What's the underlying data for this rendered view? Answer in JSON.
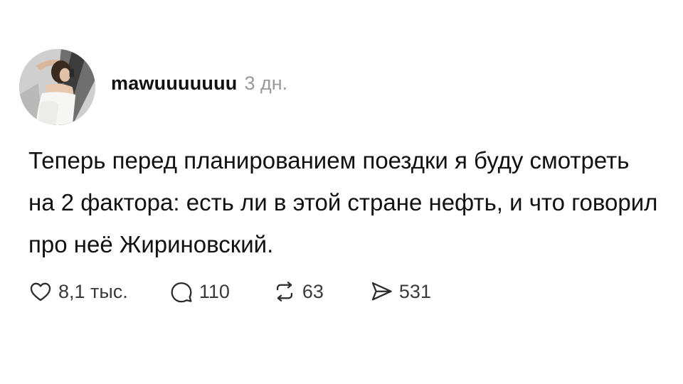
{
  "post": {
    "username": "mawuuuuuuu",
    "time": "3 дн.",
    "text": "Теперь перед планированием поездки я буду смотреть на 2 фактора: есть ли в этой стране нефть, и что говорил про неё Жириновский."
  },
  "actions": {
    "likes": "8,1 тыс.",
    "comments": "110",
    "reposts": "63",
    "shares": "531"
  },
  "icons": {
    "like": "heart-icon",
    "comment": "speech-bubble-icon",
    "repost": "repost-icon",
    "share": "send-icon"
  }
}
